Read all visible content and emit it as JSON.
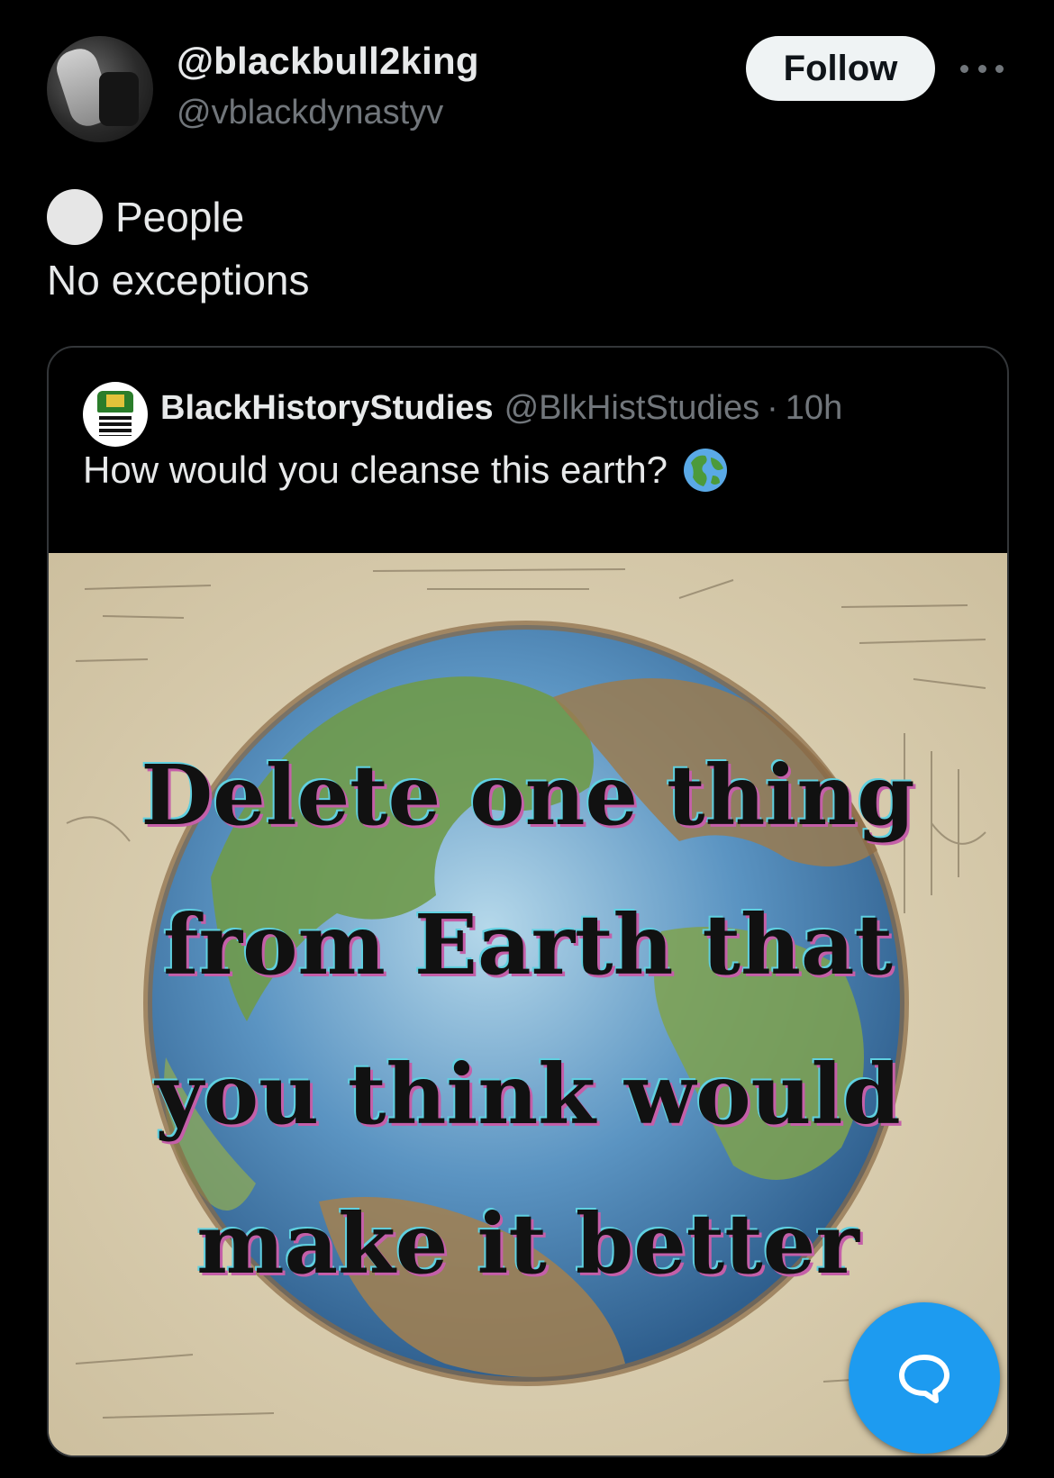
{
  "post": {
    "display_name": "@blackbull2king",
    "handle": "@vblackdynastyv",
    "follow_label": "Follow",
    "more_icon": "more-horizontal-icon",
    "text_line1": "People",
    "text_line2": "No exceptions"
  },
  "quoted": {
    "name": "BlackHistoryStudies",
    "handle": "@BlkHistStudies",
    "separator": "·",
    "time": "10h",
    "text": "How would you cleanse this earth?",
    "emoji": "globe-emoji",
    "image_text": [
      "Delete one thing",
      "from Earth that",
      "you think would",
      "make it better"
    ]
  },
  "fab": {
    "icon": "reply-bubble-icon",
    "color": "#1d9bf0"
  },
  "colors": {
    "background": "#000000",
    "text": "#e7e9ea",
    "muted": "#71767b",
    "accent": "#1d9bf0"
  }
}
